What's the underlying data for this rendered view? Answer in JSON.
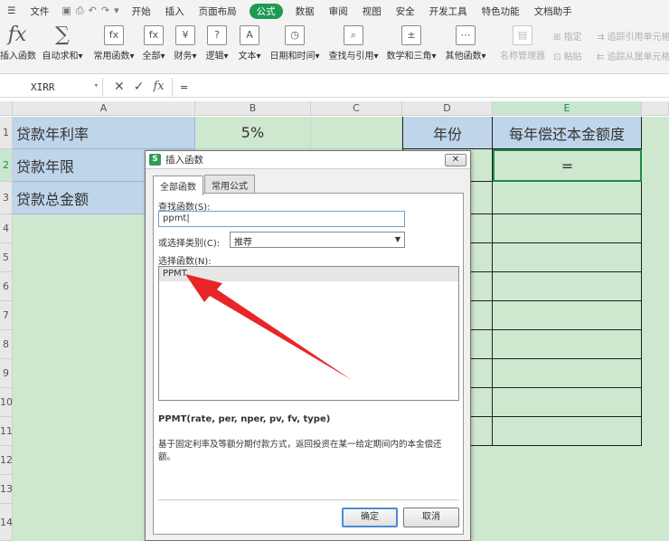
{
  "menu": {
    "file": "文件",
    "tabs": [
      "开始",
      "插入",
      "页面布局",
      "公式",
      "数据",
      "审阅",
      "视图",
      "安全",
      "开发工具",
      "特色功能",
      "文档助手"
    ],
    "active_tab": "公式"
  },
  "ribbon": {
    "insert_fn": "插入函数",
    "autosum": "自动求和",
    "common_fn": "常用函数",
    "all": "全部",
    "finance": "财务",
    "logic": "逻辑",
    "text": "文本",
    "datetime": "日期和时间",
    "lookup": "查找与引用",
    "math": "数学和三角",
    "other": "其他函数",
    "name_mgr": "名称管理器",
    "define": "指定",
    "paste": "粘贴",
    "trace_prec": "追踪引用单元格",
    "trace_dep": "追踪从属单元格"
  },
  "formula_bar": {
    "name_box": "XIRR",
    "value": "="
  },
  "columns": [
    "A",
    "B",
    "C",
    "D",
    "E"
  ],
  "rows": [
    "1",
    "2",
    "3",
    "4",
    "5",
    "6",
    "7",
    "8",
    "9",
    "10",
    "11",
    "12",
    "13",
    "14"
  ],
  "cells": {
    "A1": "贷款年利率",
    "A2": "贷款年限",
    "A3": "贷款总金额",
    "B1": "5%",
    "D1": "年份",
    "E1": "每年偿还本金额度",
    "E2": "="
  },
  "dialog": {
    "title": "插入函数",
    "close": "✕",
    "tab_all": "全部函数",
    "tab_common": "常用公式",
    "search_label": "查找函数(S):",
    "search_value": "ppmt",
    "category_label": "或选择类别(C):",
    "category_value": "推荐",
    "select_label": "选择函数(N):",
    "functions": [
      "PPMT"
    ],
    "signature": "PPMT(rate, per, nper, pv, fv, type)",
    "description": "基于固定利率及等额分期付款方式，返回投资在某一给定期间内的本金偿还额。",
    "ok": "确定",
    "cancel": "取消"
  },
  "colors": {
    "accent": "#1f9a55",
    "sheet_green": "#cee8cf",
    "header_blue": "#bfd5ea",
    "arrow_red": "#e8262a"
  }
}
